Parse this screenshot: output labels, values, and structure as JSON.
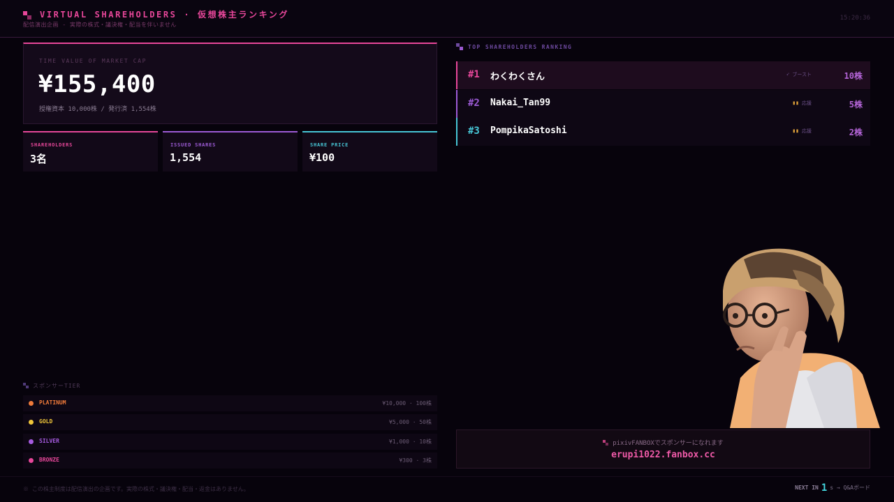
{
  "header": {
    "title": "VIRTUAL SHAREHOLDERS · 仮想株主ランキング",
    "subtitle": "配信演出企画 - 実際の株式・議決権・配当を伴いません",
    "clock": "15:20:36"
  },
  "market_cap": {
    "label": "TIME VALUE OF MARKET CAP",
    "value": "¥155,400",
    "detail": "授権資本 10,000株 / 発行済 1,554株"
  },
  "stats": [
    {
      "label": "SHAREHOLDERS",
      "value": "3名",
      "color": "#e8479a"
    },
    {
      "label": "ISSUED SHARES",
      "value": "1,554",
      "color": "#9d5bd6"
    },
    {
      "label": "SHARE PRICE",
      "value": "¥100",
      "color": "#47c6d6"
    }
  ],
  "tiers": {
    "heading": "スポンサーTIER",
    "items": [
      {
        "name": "PLATINUM",
        "price": "¥10,000 · 100株",
        "color": "#ef7a3a"
      },
      {
        "name": "GOLD",
        "price": "¥5,000 · 50株",
        "color": "#f0c63a"
      },
      {
        "name": "SILVER",
        "price": "¥1,000 · 10株",
        "color": "#a65be0"
      },
      {
        "name": "BRONZE",
        "price": "¥300 · 3株",
        "color": "#e8479a"
      }
    ]
  },
  "footer_note": "※ この株主制度は配信演出の企画です。実際の株式・議決権・配当・返金はありません。",
  "ranking": {
    "heading": "TOP SHAREHOLDERS RANKING",
    "rows": [
      {
        "rank": "#1",
        "name": "わくわくさん",
        "badge": "ブースト",
        "badge_icon": "rocket-icon",
        "shares": "10株",
        "color": "#e8479a"
      },
      {
        "rank": "#2",
        "name": "Nakai_Tan99",
        "badge": "応援",
        "badge_icon": "cheer-icon",
        "shares": "5株",
        "color": "#9d5bd6"
      },
      {
        "rank": "#3",
        "name": "PompikaSatoshi",
        "badge": "応援",
        "badge_icon": "cheer-icon",
        "shares": "2株",
        "color": "#47c6d6"
      }
    ]
  },
  "fanbox": {
    "line1": "pixivFANBOXでスポンサーになれます",
    "url": "erupi1022.fanbox.cc"
  },
  "next": {
    "label": "NEXT IN",
    "count": "1",
    "suffix": "s → Q&Aボード"
  }
}
